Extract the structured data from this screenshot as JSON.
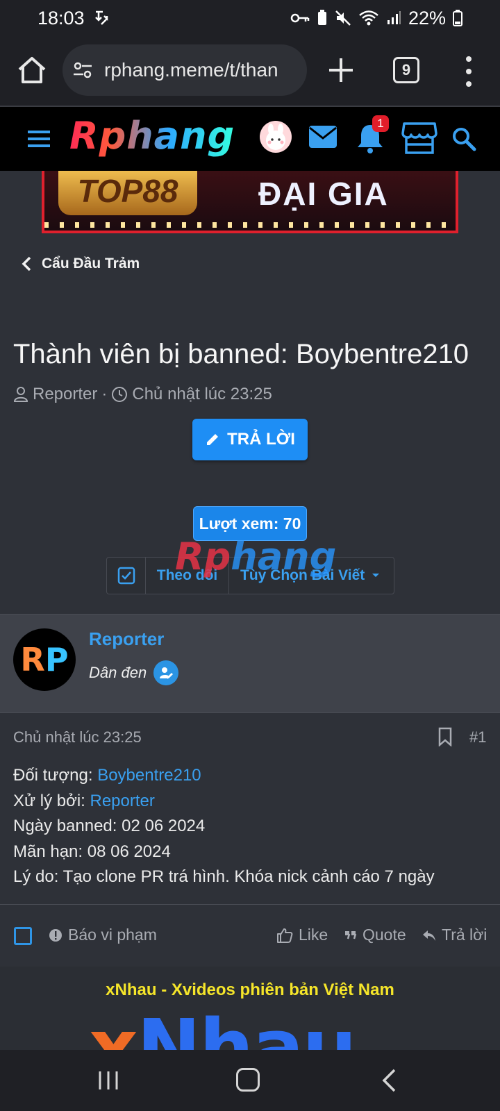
{
  "status_bar": {
    "time": "18:03",
    "battery": "22%"
  },
  "browser": {
    "url": "rphang.meme/t/than",
    "tab_count": "9"
  },
  "site": {
    "logo": "Rphang",
    "notification_count": "1"
  },
  "banner": {
    "left_text": "TOP88",
    "right_text": "ĐẠI GIA"
  },
  "breadcrumb": {
    "label": "Cẩu Đầu Trảm"
  },
  "thread": {
    "title": "Thành viên bị banned: Boybentre210",
    "author": "Reporter",
    "separator": "·",
    "time": "Chủ nhật lúc 23:25",
    "reply_label": "TRẢ LỜI",
    "views_label": "Lượt xem: 70",
    "watermark_a": "Rp",
    "watermark_b": "hang",
    "follow_label": "Theo dõi",
    "options_label": "Tùy Chọn Bài Viết"
  },
  "post": {
    "user_name": "Reporter",
    "user_title": "Dân đen",
    "avatar_initials": {
      "a": "R",
      "b": "P"
    },
    "date": "Chủ nhật lúc 23:25",
    "number": "#1",
    "lines": {
      "target_label": "Đối tượng: ",
      "target_value": "Boybentre210",
      "handled_label": "Xử lý bởi: ",
      "handled_value": "Reporter",
      "banned_date": "Ngày banned: 02 06 2024",
      "expiry": "Mãn hạn: 08 06 2024",
      "reason": "Lý do: Tạo clone PR trá hình. Khóa nick cảnh cáo 7 ngày"
    },
    "actions": {
      "report": "Báo vi phạm",
      "like": "Like",
      "quote": "Quote",
      "reply": "Trả lời"
    }
  },
  "ad": {
    "text": "xNhau - Xvideos phiên bản Việt Nam",
    "logo_a": "x",
    "logo_b": "Nhau"
  }
}
